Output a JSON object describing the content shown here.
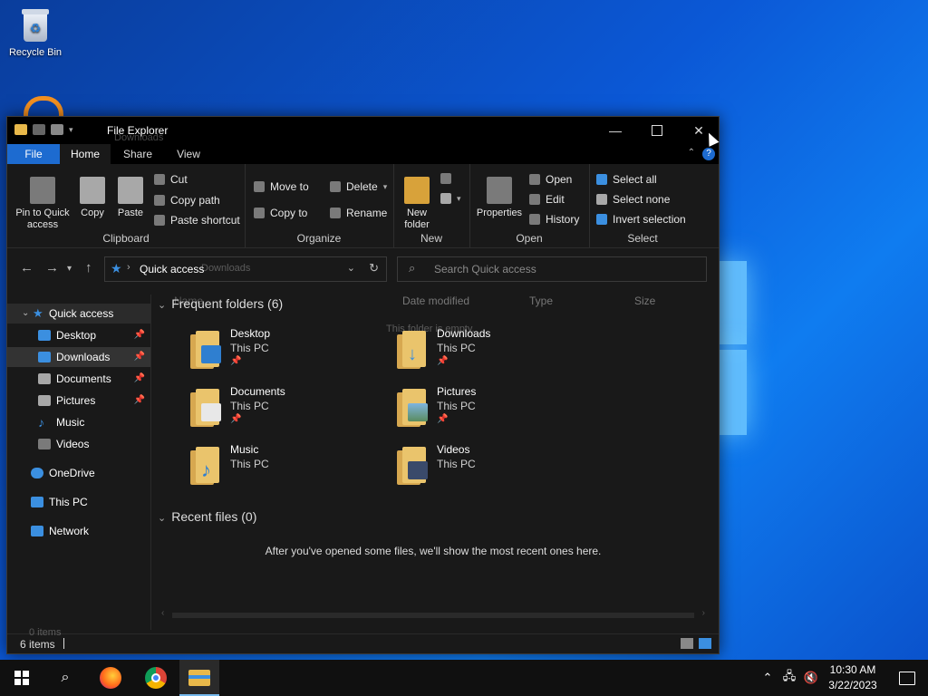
{
  "desktop": {
    "recycle_bin_label": "Recycle Bin"
  },
  "window": {
    "title": "File Explorer",
    "ghost_title": "Downloads",
    "tabs": [
      {
        "label": "File"
      },
      {
        "label": "Home"
      },
      {
        "label": "Share"
      },
      {
        "label": "View"
      }
    ],
    "help_label": "?"
  },
  "ribbon": {
    "clipboard": {
      "label": "Clipboard",
      "pin_label": "Pin to Quick access",
      "copy_label": "Copy",
      "paste_label": "Paste",
      "cut_label": "Cut",
      "copy_path_label": "Copy path",
      "paste_shortcut_label": "Paste shortcut"
    },
    "organize": {
      "label": "Organize",
      "move_to_label": "Move to",
      "copy_to_label": "Copy to",
      "delete_label": "Delete",
      "rename_label": "Rename"
    },
    "new": {
      "label": "New",
      "new_folder_label": "New folder"
    },
    "open": {
      "label": "Open",
      "properties_label": "Properties",
      "open_label": "Open",
      "edit_label": "Edit",
      "history_label": "History"
    },
    "select": {
      "label": "Select",
      "select_all_label": "Select all",
      "select_none_label": "Select none",
      "invert_label": "Invert selection"
    }
  },
  "address": {
    "crumb": "Quick access",
    "ghost_crumb": "Downloads",
    "search_placeholder": "Search Quick access"
  },
  "nav": {
    "items": [
      {
        "label": "Quick access"
      },
      {
        "label": "Desktop"
      },
      {
        "label": "Downloads"
      },
      {
        "label": "Documents"
      },
      {
        "label": "Pictures"
      },
      {
        "label": "Music"
      },
      {
        "label": "Videos"
      },
      {
        "label": "OneDrive"
      },
      {
        "label": "This PC"
      },
      {
        "label": "Network"
      }
    ]
  },
  "content": {
    "columns": [
      "Name",
      "Date modified",
      "Type",
      "Size"
    ],
    "ghost_empty": "This folder is empty.",
    "frequent_header": "Frequent folders (6)",
    "recent_header": "Recent files (0)",
    "recent_empty": "After you've opened some files, we'll show the most recent ones here.",
    "folders": [
      {
        "name": "Desktop",
        "location": "This PC"
      },
      {
        "name": "Downloads",
        "location": "This PC"
      },
      {
        "name": "Documents",
        "location": "This PC"
      },
      {
        "name": "Pictures",
        "location": "This PC"
      },
      {
        "name": "Music",
        "location": "This PC"
      },
      {
        "name": "Videos",
        "location": "This PC"
      }
    ]
  },
  "status": {
    "count": "6 items",
    "ghost_count": "0 items"
  },
  "taskbar": {
    "time": "10:30 AM",
    "date": "3/22/2023"
  },
  "colors": {
    "accent": "#1d6bd0",
    "folder": "#eac46c"
  }
}
